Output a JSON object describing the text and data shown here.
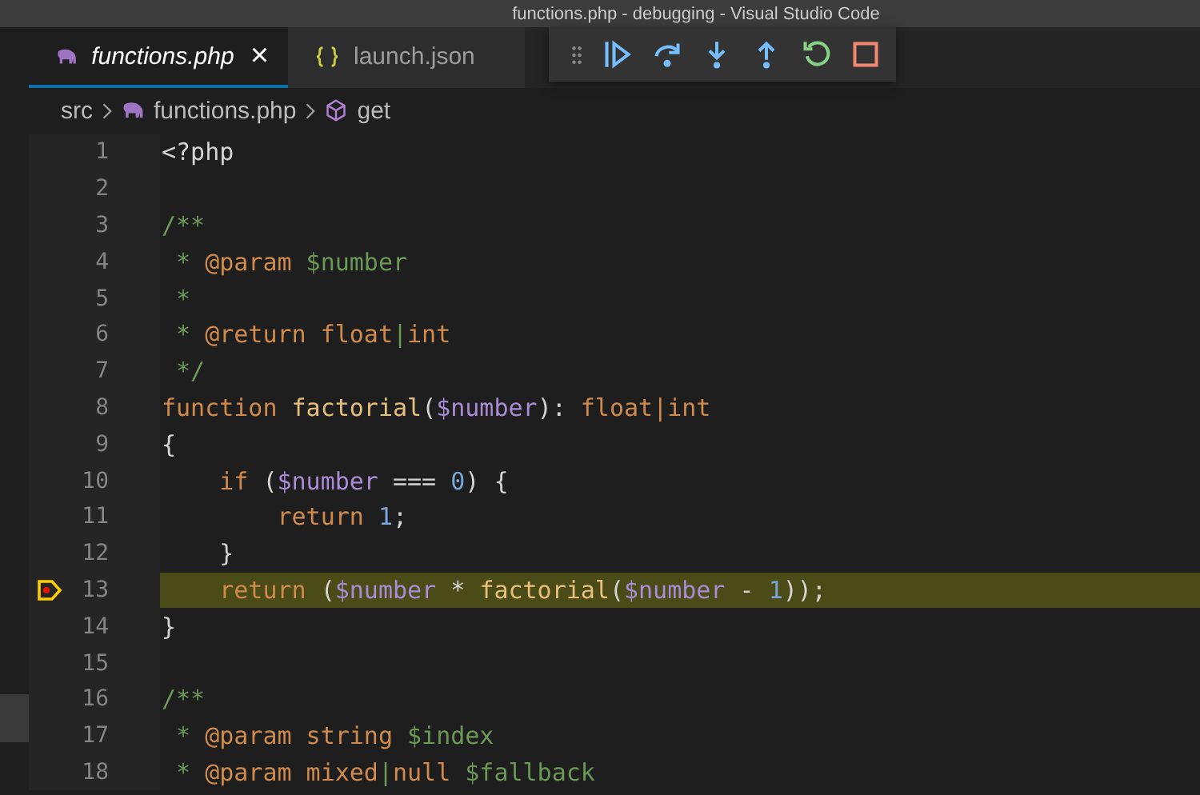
{
  "window": {
    "title": "functions.php - debugging - Visual Studio Code"
  },
  "tabs": [
    {
      "label": "functions.php",
      "kind": "php",
      "selected": true,
      "close": "×"
    },
    {
      "label": "launch.json",
      "kind": "json",
      "selected": false
    }
  ],
  "breadcrumbs": [
    {
      "label": "src",
      "kind": "folder"
    },
    {
      "label": "functions.php",
      "kind": "php"
    },
    {
      "label": "get",
      "kind": "symbol"
    }
  ],
  "debug_toolbar": [
    {
      "kind": "grip"
    },
    {
      "kind": "continue"
    },
    {
      "kind": "step-over"
    },
    {
      "kind": "step-into"
    },
    {
      "kind": "step-out"
    },
    {
      "kind": "restart"
    },
    {
      "kind": "stop"
    }
  ],
  "editor": {
    "lines": [
      {
        "number": "1",
        "current": false,
        "tokens": [
          {
            "text": "<?php",
            "kind": "plain"
          }
        ]
      },
      {
        "number": "2",
        "current": false
      },
      {
        "number": "3",
        "current": false,
        "tokens": [
          {
            "text": "/**",
            "kind": "comment"
          }
        ]
      },
      {
        "number": "4",
        "current": false,
        "tokens": [
          {
            "text": " * ",
            "kind": "comment"
          },
          {
            "text": "@param",
            "kind": "tag"
          },
          {
            "text": " $number",
            "kind": "comment"
          }
        ]
      },
      {
        "number": "5",
        "current": false,
        "tokens": [
          {
            "text": " *",
            "kind": "comment"
          }
        ]
      },
      {
        "number": "6",
        "current": false,
        "tokens": [
          {
            "text": " * ",
            "kind": "comment"
          },
          {
            "text": "@return",
            "kind": "tag"
          },
          {
            "text": " float",
            "kind": "tag"
          },
          {
            "text": "|",
            "kind": "comment"
          },
          {
            "text": "int",
            "kind": "tag"
          }
        ]
      },
      {
        "number": "7",
        "current": false,
        "tokens": [
          {
            "text": " */",
            "kind": "comment"
          }
        ]
      },
      {
        "number": "8",
        "current": false,
        "tokens": [
          {
            "text": "function",
            "kind": "keyword"
          },
          {
            "text": " factorial",
            "kind": "function"
          },
          {
            "text": "(",
            "kind": "plain"
          },
          {
            "text": "$number",
            "kind": "variable"
          },
          {
            "text": "): ",
            "kind": "plain"
          },
          {
            "text": "float",
            "kind": "keyword"
          },
          {
            "text": "|",
            "kind": "operator"
          },
          {
            "text": "int",
            "kind": "keyword"
          }
        ]
      },
      {
        "number": "9",
        "current": false,
        "tokens": [
          {
            "text": "{",
            "kind": "plain"
          }
        ]
      },
      {
        "number": "10",
        "current": false,
        "tokens": [
          {
            "text": "    if",
            "kind": "keyword"
          },
          {
            "text": " (",
            "kind": "plain"
          },
          {
            "text": "$number",
            "kind": "variable"
          },
          {
            "text": " === ",
            "kind": "plain"
          },
          {
            "text": "0",
            "kind": "number"
          },
          {
            "text": ") {",
            "kind": "plain"
          }
        ]
      },
      {
        "number": "11",
        "current": false,
        "tokens": [
          {
            "text": "        return",
            "kind": "keyword"
          },
          {
            "text": " 1",
            "kind": "number"
          },
          {
            "text": ";",
            "kind": "plain"
          }
        ]
      },
      {
        "number": "12",
        "current": false,
        "tokens": [
          {
            "text": "    }",
            "kind": "plain"
          }
        ]
      },
      {
        "number": "13",
        "current": true,
        "tokens": [
          {
            "text": "    return",
            "kind": "keyword"
          },
          {
            "text": " (",
            "kind": "plain"
          },
          {
            "text": "$number",
            "kind": "variable"
          },
          {
            "text": " * ",
            "kind": "plain"
          },
          {
            "text": "factorial",
            "kind": "function"
          },
          {
            "text": "(",
            "kind": "plain"
          },
          {
            "text": "$number",
            "kind": "variable"
          },
          {
            "text": " - ",
            "kind": "plain"
          },
          {
            "text": "1",
            "kind": "number"
          },
          {
            "text": "));",
            "kind": "plain"
          }
        ]
      },
      {
        "number": "14",
        "current": false,
        "tokens": [
          {
            "text": "}",
            "kind": "plain"
          }
        ]
      },
      {
        "number": "15",
        "current": false
      },
      {
        "number": "16",
        "current": false,
        "tokens": [
          {
            "text": "/**",
            "kind": "comment"
          }
        ]
      },
      {
        "number": "17",
        "current": false,
        "tokens": [
          {
            "text": " * ",
            "kind": "comment"
          },
          {
            "text": "@param",
            "kind": "tag"
          },
          {
            "text": " string",
            "kind": "tag"
          },
          {
            "text": " $index",
            "kind": "comment"
          }
        ]
      },
      {
        "number": "18",
        "current": false,
        "tokens": [
          {
            "text": " * ",
            "kind": "comment"
          },
          {
            "text": "@param",
            "kind": "tag"
          },
          {
            "text": " mixed",
            "kind": "tag"
          },
          {
            "text": "|",
            "kind": "comment"
          },
          {
            "text": "null",
            "kind": "tag"
          },
          {
            "text": " $fallback",
            "kind": "comment"
          }
        ]
      }
    ]
  }
}
